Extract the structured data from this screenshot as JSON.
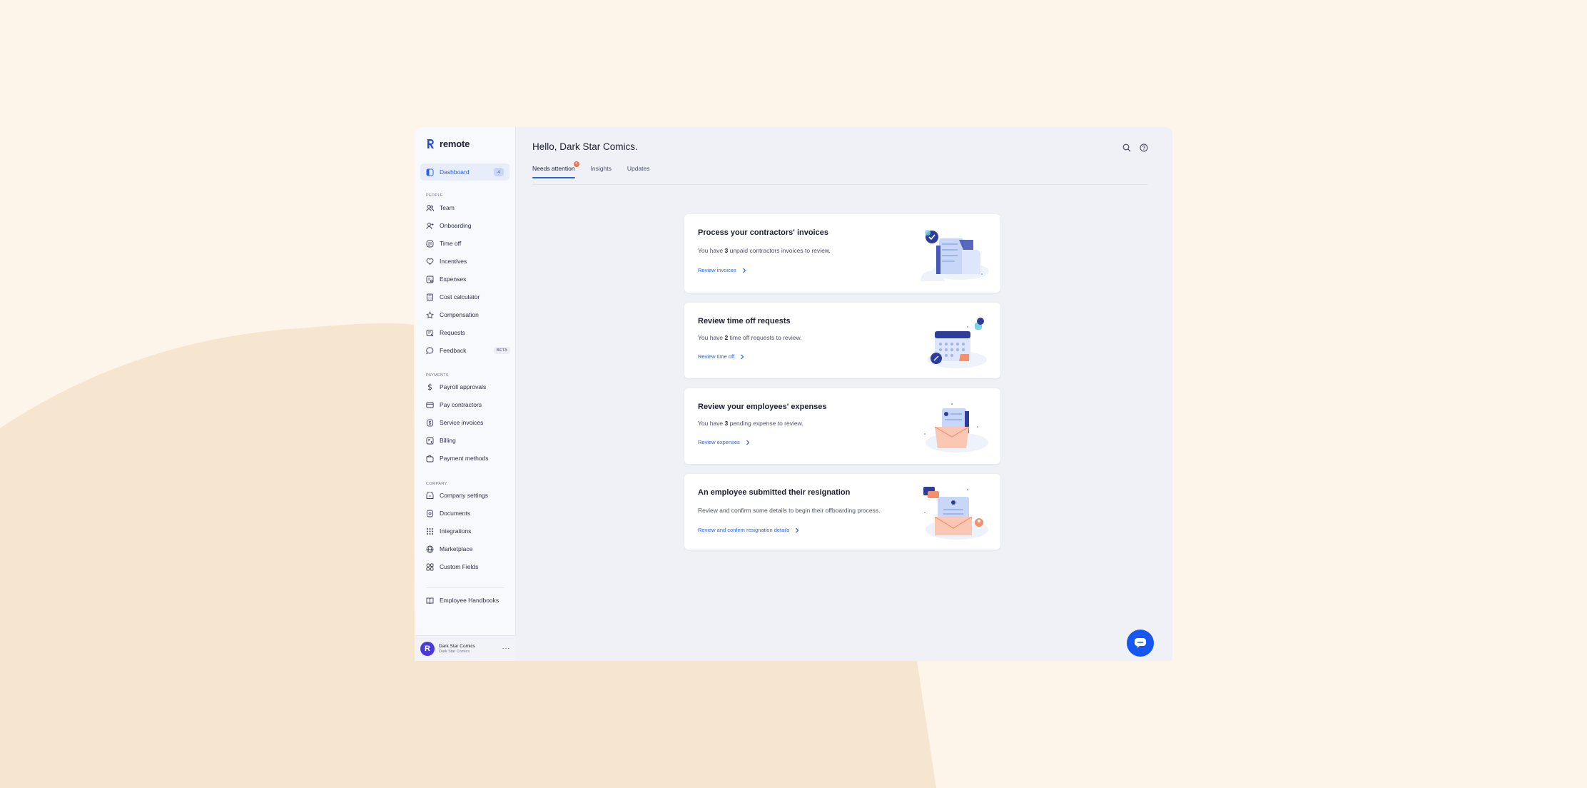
{
  "app": {
    "brand": "remote"
  },
  "sidebar": {
    "dashboard": {
      "label": "Dashboard",
      "badge": "4"
    },
    "sections": {
      "people": "PEOPLE",
      "payments": "PAYMENTS",
      "company": "COMPANY"
    },
    "people_items": [
      {
        "label": "Team",
        "icon": "team-icon"
      },
      {
        "label": "Onboarding",
        "icon": "user-plus-icon"
      },
      {
        "label": "Time off",
        "icon": "time-off-icon"
      },
      {
        "label": "Incentives",
        "icon": "heart-icon"
      },
      {
        "label": "Expenses",
        "icon": "expenses-icon"
      },
      {
        "label": "Cost calculator",
        "icon": "calculator-icon"
      },
      {
        "label": "Compensation",
        "icon": "star-icon"
      },
      {
        "label": "Requests",
        "icon": "requests-icon"
      },
      {
        "label": "Feedback",
        "icon": "chat-bubble-icon",
        "badge": "BETA"
      }
    ],
    "payments_items": [
      {
        "label": "Payroll approvals",
        "icon": "dollar-icon"
      },
      {
        "label": "Pay contractors",
        "icon": "card-icon"
      },
      {
        "label": "Service invoices",
        "icon": "invoice-icon"
      },
      {
        "label": "Billing",
        "icon": "billing-icon"
      },
      {
        "label": "Payment methods",
        "icon": "wallet-icon"
      }
    ],
    "company_items": [
      {
        "label": "Company settings",
        "icon": "building-icon"
      },
      {
        "label": "Documents",
        "icon": "document-icon"
      },
      {
        "label": "Integrations",
        "icon": "grid-icon"
      },
      {
        "label": "Marketplace",
        "icon": "globe-icon"
      },
      {
        "label": "Custom Fields",
        "icon": "fields-icon"
      }
    ],
    "extra_item": {
      "label": "Employee Handbooks",
      "icon": "book-icon"
    },
    "account": {
      "initial": "R",
      "name": "Dark Star Comics",
      "sub": "Dark Star Comics",
      "more": "···"
    }
  },
  "main": {
    "greeting": "Hello, Dark Star Comics.",
    "tabs": [
      {
        "label": "Needs attention",
        "dot": "4"
      },
      {
        "label": "Insights"
      },
      {
        "label": "Updates"
      }
    ],
    "cards": [
      {
        "title": "Process your contractors' invoices",
        "text_pre": "You have ",
        "count": "3",
        "text_post": " unpaid contractors invoices to review.",
        "link": "Review invoices"
      },
      {
        "title": "Review time off requests",
        "text_pre": "You have ",
        "count": "2",
        "text_post": " time off requests to review.",
        "link": "Review time off"
      },
      {
        "title": "Review your employees' expenses",
        "text_pre": "You have ",
        "count": "3",
        "text_post": " pending expense to review.",
        "link": "Review expenses"
      },
      {
        "title": "An employee submitted their resignation",
        "text": "Review and confirm some details to begin their offboarding process.",
        "link": "Review and confirm resignation details"
      }
    ]
  },
  "colors": {
    "accent": "#2463eb",
    "background": "#fdf5ea",
    "app_bg": "#eff1f7",
    "notification": "#f3714f"
  }
}
